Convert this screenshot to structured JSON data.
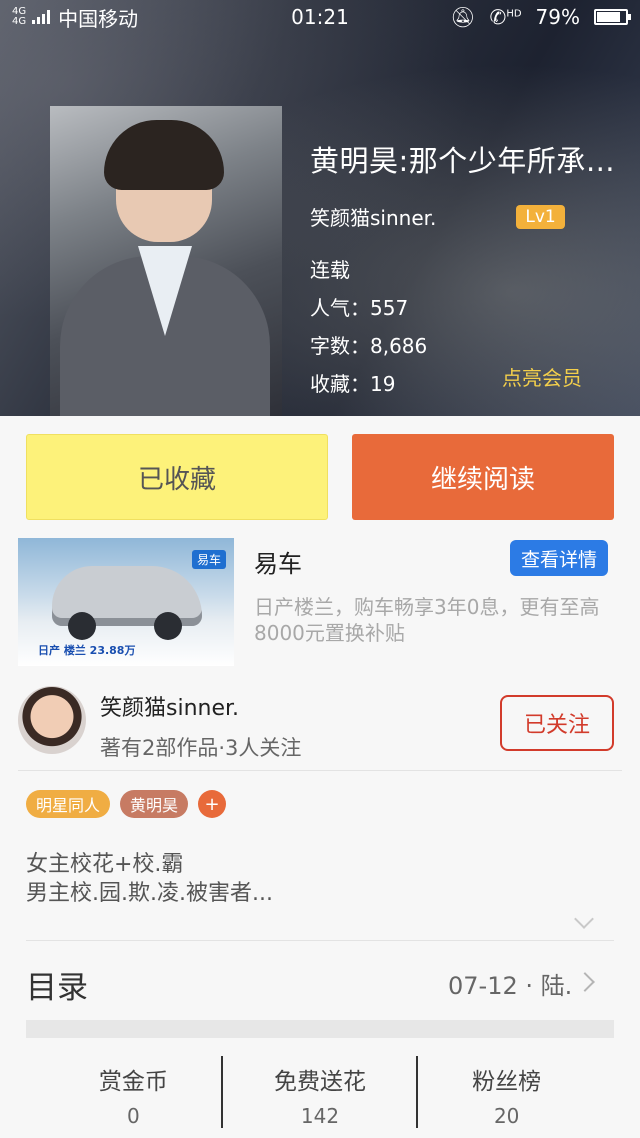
{
  "status_bar": {
    "network_top": "4G",
    "network_bottom": "4G",
    "carrier": "中国移动",
    "time": "01:21",
    "hd": "HD",
    "battery": "79%"
  },
  "book": {
    "title": "黄明昊:那个少年所承…",
    "author": "笑颜猫sinner.",
    "level": "Lv1",
    "status": "连载",
    "popularity_label": "人气：",
    "popularity": "557",
    "words_label": "字数：",
    "words": "8,686",
    "favorites_label": "收藏：",
    "favorites": "19",
    "vip_link": "点亮会员"
  },
  "actions": {
    "collected": "已收藏",
    "continue_reading": "继续阅读"
  },
  "ad": {
    "brand_badge": "易车",
    "strip_text": "日产 楼兰  23.88万",
    "title": "易车",
    "detail_button": "查看详情",
    "description": "日产楼兰，购车畅享3年0息，更有至高8000元置换补贴"
  },
  "author_card": {
    "name": "笑颜猫sinner.",
    "subtitle": "著有2部作品·3人关注",
    "follow_button": "已关注"
  },
  "tags": [
    "明星同人",
    "黄明昊"
  ],
  "tag_add": "+",
  "intro": {
    "line1": "女主校花+校.霸",
    "line2": "男主校.园.欺.凌.被害者..."
  },
  "catalog": {
    "label": "目录",
    "latest": "07-12 · 陆."
  },
  "stats": [
    {
      "label": "赏金币",
      "value": "0"
    },
    {
      "label": "免费送花",
      "value": "142"
    },
    {
      "label": "粉丝榜",
      "value": "20"
    }
  ]
}
